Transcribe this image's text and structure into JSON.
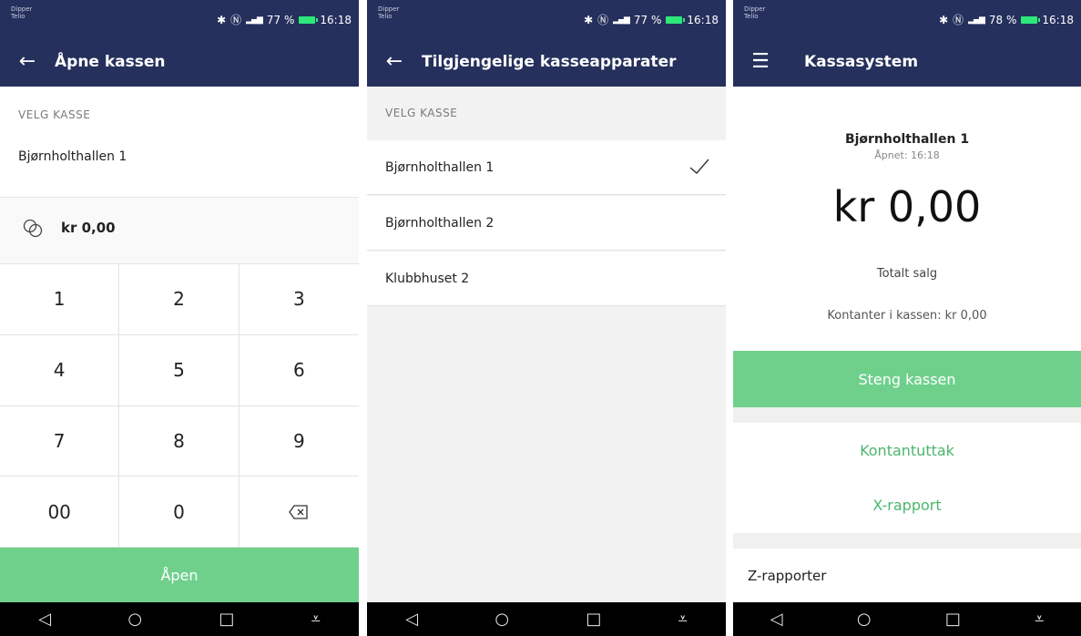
{
  "status": {
    "carrier_line1": "Dipper",
    "carrier_line2": "Telio",
    "s1_battery": "77 %",
    "s2_battery": "77 %",
    "s3_battery": "78 %",
    "time": "16:18"
  },
  "screen1": {
    "title": "Åpne kassen",
    "section_label": "VELG KASSE",
    "selected_register": "Bjørnholthallen 1",
    "amount": "kr 0,00",
    "keys": [
      "1",
      "2",
      "3",
      "4",
      "5",
      "6",
      "7",
      "8",
      "9",
      "00",
      "0"
    ],
    "open_button": "Åpen"
  },
  "screen2": {
    "title": "Tilgjengelige kasseapparater",
    "section_label": "VELG KASSE",
    "registers": [
      "Bjørnholthallen 1",
      "Bjørnholthallen 2",
      "Klubbhuset 2"
    ]
  },
  "screen3": {
    "title": "Kassasystem",
    "register_name": "Bjørnholthallen 1",
    "opened_at": "Åpnet: 16:18",
    "total": "kr 0,00",
    "total_label": "Totalt salg",
    "cash_in_register": "Kontanter i kassen: kr 0,00",
    "close_button": "Steng kassen",
    "cash_withdrawal": "Kontantuttak",
    "x_report": "X-rapport",
    "z_reports": "Z-rapporter"
  },
  "colors": {
    "appbar": "#25305c",
    "accent_green": "#6fd08c",
    "link_green": "#4cb56d"
  }
}
